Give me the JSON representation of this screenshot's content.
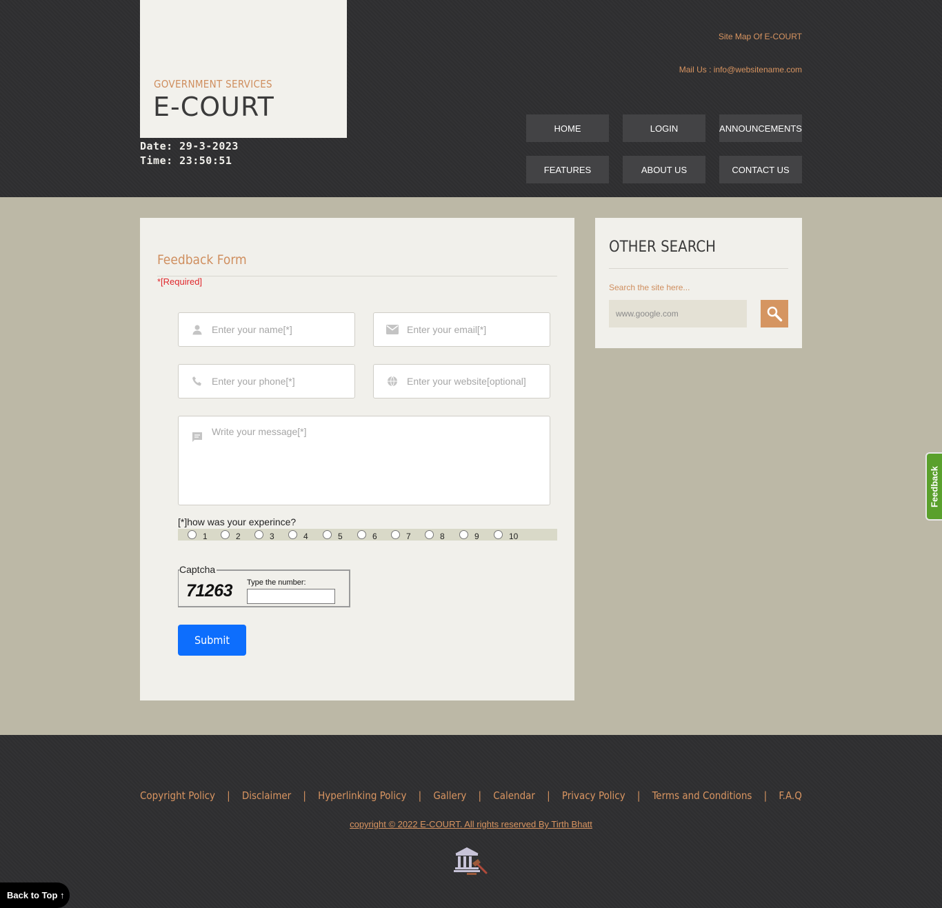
{
  "header": {
    "logo_subtitle": "GOVERNMENT SERVICES",
    "logo_title": "E-COURT",
    "date_text": "Date: 29-3-2023",
    "time_text": "Time: 23:50:51",
    "sitemap_link": "Site Map Of E-COURT",
    "mail_text": "Mail Us : info@websitename.com",
    "nav": {
      "home": "HOME",
      "login": "LOGIN",
      "announcements": "ANNOUNCEMENTS",
      "features": "FEATURES",
      "about": "ABOUT US",
      "contact": "CONTACT US"
    }
  },
  "form": {
    "title": "Feedback Form",
    "required_note": "*[Required]",
    "name_placeholder": "Enter your name[*]",
    "email_placeholder": "Enter your email[*]",
    "phone_placeholder": "Enter your phone[*]",
    "website_placeholder": "Enter your website[optional]",
    "message_placeholder": "Write your message[*]",
    "experience_label": "[*]how was your experince?",
    "ratings": [
      "1",
      "2",
      "3",
      "4",
      "5",
      "6",
      "7",
      "8",
      "9",
      "10"
    ],
    "captcha_legend": "Captcha",
    "captcha_code": "71263",
    "captcha_hint": "Type the number:",
    "submit_label": "Submit"
  },
  "sidebar": {
    "title": "OTHER SEARCH",
    "hint": "Search the site here...",
    "search_placeholder": "www.google.com"
  },
  "feedback_tab": "Feedback",
  "footer": {
    "links": {
      "copyright_policy": "Copyright Policy",
      "disclaimer": "Disclaimer",
      "hyperlinking": "Hyperlinking Policy",
      "gallery": "Gallery",
      "calendar": "Calendar",
      "privacy": "Privacy Policy",
      "terms": "Terms and Conditions",
      "faq": "F.A.Q"
    },
    "separator": "|",
    "copyright": "copyright © 2022 E-COURT. All rights reserved By Tirth Bhatt"
  },
  "back_to_top": "Back to Top ↑",
  "colors": {
    "accent": "#d99561",
    "dark_bg": "#2f2f31",
    "page_bg": "#bcb8a6",
    "card_bg": "#f1f0eb",
    "submit_blue": "#0d6efd",
    "feedback_green": "#5aa02c",
    "required_red": "#e0262b"
  }
}
